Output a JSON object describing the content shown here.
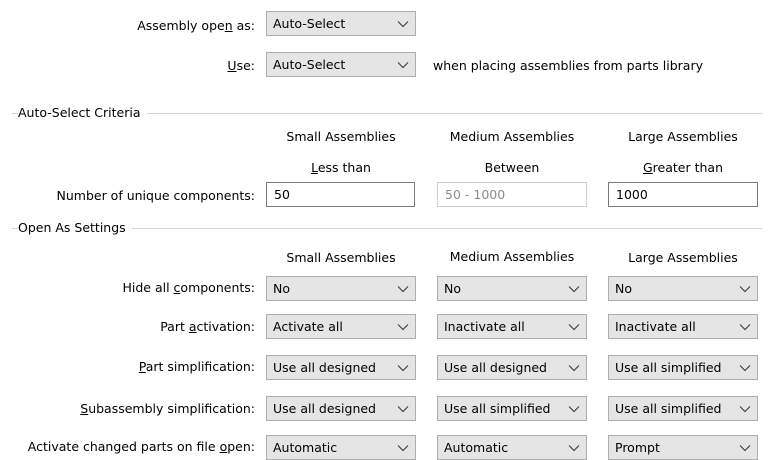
{
  "top": {
    "assembly_open_as": {
      "label_pre": "Assembly ope",
      "label_u": "n",
      "label_post": " as:",
      "value": "Auto-Select"
    },
    "use": {
      "label_pre": "",
      "label_u": "U",
      "label_post": "se:",
      "value": "Auto-Select",
      "suffix": "when placing assemblies from parts library"
    }
  },
  "auto_select": {
    "title": "Auto-Select Criteria",
    "columns": [
      {
        "title": "Small Assemblies",
        "sub_pre": "",
        "sub_u": "L",
        "sub_post": "ess than"
      },
      {
        "title": "Medium Assemblies",
        "sub_pre": "Between",
        "sub_u": "",
        "sub_post": ""
      },
      {
        "title": "Large Assemblies",
        "sub_pre": "",
        "sub_u": "G",
        "sub_post": "reater than"
      }
    ],
    "row_label": "Number of unique components:",
    "values": {
      "small": "50",
      "medium": "50 - 1000",
      "large": "1000"
    }
  },
  "open_as": {
    "title": "Open As Settings",
    "columns": [
      "Small Assemblies",
      "Medium Assemblies",
      "Large Assemblies"
    ],
    "rows": [
      {
        "label_pre": "Hide all ",
        "label_u": "c",
        "label_post": "omponents:",
        "small": "No",
        "medium": "No",
        "large": "No"
      },
      {
        "label_pre": "Part ",
        "label_u": "a",
        "label_post": "ctivation:",
        "small": "Activate all",
        "medium": "Inactivate all",
        "large": "Inactivate all"
      },
      {
        "label_pre": "",
        "label_u": "P",
        "label_post": "art simplification:",
        "small": "Use all designed",
        "medium": "Use all designed",
        "large": "Use all simplified"
      },
      {
        "label_pre": "",
        "label_u": "S",
        "label_post": "ubassembly simplification:",
        "small": "Use all designed",
        "medium": "Use all simplified",
        "large": "Use all simplified"
      },
      {
        "label_pre": "Activate changed parts on file ",
        "label_u": "o",
        "label_post": "pen:",
        "small": "Automatic",
        "medium": "Automatic",
        "large": "Prompt"
      }
    ]
  },
  "icons": {
    "dropdown": "chevron-down-icon"
  }
}
